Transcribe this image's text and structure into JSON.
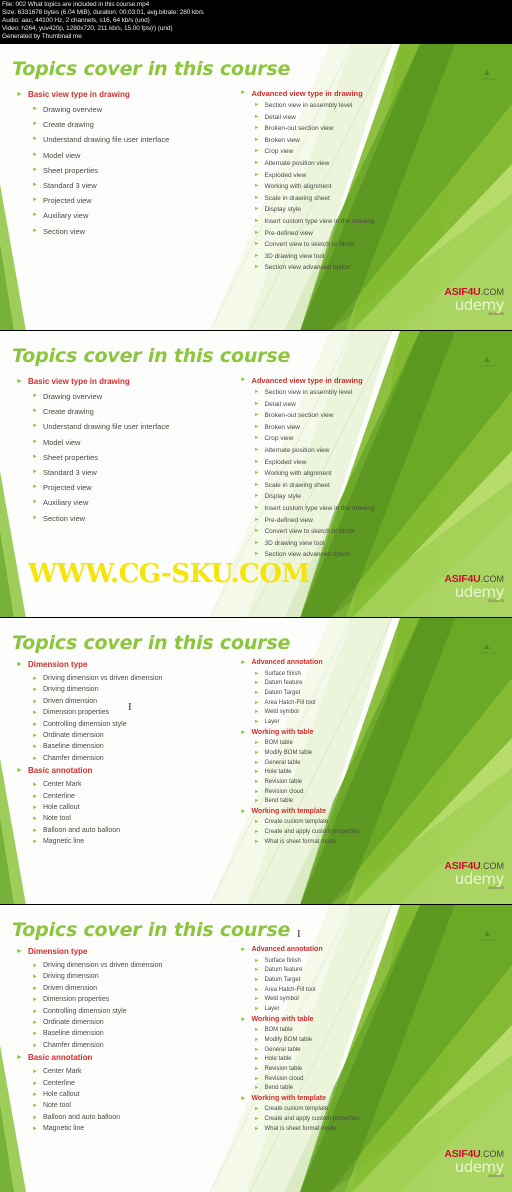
{
  "meta": {
    "lines": [
      "File: 002 What topics are included in this course.mp4",
      "Size: 6331678 bytes (6.04 MiB), duration: 00:03:01, avg.bitrate: 280 kb/s",
      "Audio: aac, 44100 Hz, 2 channels, s16, 64 kb/s (und)",
      "Video: h264, yuv420p, 1280x720, 211 kb/s, 15.00 fps(r) (und)",
      "Generated by Thumbnail me"
    ]
  },
  "branding": {
    "asif": "ASIF4U",
    "com": ".COM",
    "udemy": "udemy",
    "stamp": "00:00:20",
    "corner_mark": "▲",
    "corner_caption": "SolidWorks"
  },
  "watermark": "WWW.CG-SKU.COM",
  "slide_title": "Topics cover in this course",
  "frames": [
    {
      "index": 1,
      "left_column": [
        {
          "type": "heading",
          "label": "Basic view type in drawing"
        },
        {
          "type": "item",
          "label": "Drawing overview"
        },
        {
          "type": "item",
          "label": "Create drawing"
        },
        {
          "type": "item",
          "label": "Understand drawing file user interface"
        },
        {
          "type": "item",
          "label": "Model view"
        },
        {
          "type": "item",
          "label": "Sheet properties"
        },
        {
          "type": "item",
          "label": "Standard 3 view"
        },
        {
          "type": "item",
          "label": "Projected view"
        },
        {
          "type": "item",
          "label": "Auxiliary view"
        },
        {
          "type": "item",
          "label": "Section view"
        }
      ],
      "right_column": [
        {
          "type": "heading",
          "label": "Advanced view type in drawing"
        },
        {
          "type": "item",
          "label": "Section view in assembly level"
        },
        {
          "type": "item",
          "label": "Detail view"
        },
        {
          "type": "item",
          "label": "Broken-out section view"
        },
        {
          "type": "item",
          "label": "Broken view"
        },
        {
          "type": "item",
          "label": "Crop view"
        },
        {
          "type": "item",
          "label": "Alternate position view"
        },
        {
          "type": "item",
          "label": "Exploded view"
        },
        {
          "type": "item",
          "label": "Working with alignment"
        },
        {
          "type": "item",
          "label": "Scale in drawing sheet"
        },
        {
          "type": "item",
          "label": "Display style"
        },
        {
          "type": "item",
          "label": "Insert custom type view in the drawing"
        },
        {
          "type": "item",
          "label": "Pre-defined view"
        },
        {
          "type": "item",
          "label": "Convert view to sketch or block"
        },
        {
          "type": "item",
          "label": "3D drawing view tool"
        },
        {
          "type": "item",
          "label": "Section view advanced option"
        }
      ]
    },
    {
      "index": 2,
      "left_column": [
        {
          "type": "heading",
          "label": "Basic view type in drawing"
        },
        {
          "type": "item",
          "label": "Drawing overview"
        },
        {
          "type": "item",
          "label": "Create drawing"
        },
        {
          "type": "item",
          "label": "Understand drawing file user interface"
        },
        {
          "type": "item",
          "label": "Model view"
        },
        {
          "type": "item",
          "label": "Sheet properties"
        },
        {
          "type": "item",
          "label": "Standard 3 view"
        },
        {
          "type": "item",
          "label": "Projected view"
        },
        {
          "type": "item",
          "label": "Auxiliary view"
        },
        {
          "type": "item",
          "label": "Section view"
        }
      ],
      "right_column": [
        {
          "type": "heading",
          "label": "Advanced view type in drawing"
        },
        {
          "type": "item",
          "label": "Section view in assembly level"
        },
        {
          "type": "item",
          "label": "Detail view"
        },
        {
          "type": "item",
          "label": "Broken-out section view"
        },
        {
          "type": "item",
          "label": "Broken view"
        },
        {
          "type": "item",
          "label": "Crop view"
        },
        {
          "type": "item",
          "label": "Alternate position view"
        },
        {
          "type": "item",
          "label": "Exploded view"
        },
        {
          "type": "item",
          "label": "Working with alignment"
        },
        {
          "type": "item",
          "label": "Scale in drawing sheet"
        },
        {
          "type": "item",
          "label": "Display style"
        },
        {
          "type": "item",
          "label": "Insert custom type view in the drawing"
        },
        {
          "type": "item",
          "label": "Pre-defined view"
        },
        {
          "type": "item",
          "label": "Convert view to sketch or block"
        },
        {
          "type": "item",
          "label": "3D drawing view tool"
        },
        {
          "type": "item",
          "label": "Section view advanced option"
        }
      ]
    },
    {
      "index": 3,
      "left_column": [
        {
          "type": "heading",
          "label": "Dimension type"
        },
        {
          "type": "item",
          "label": "Driving dimension vs driven dimension"
        },
        {
          "type": "item",
          "label": "Driving dimension"
        },
        {
          "type": "item",
          "label": "Driven dimension"
        },
        {
          "type": "item",
          "label": "Dimension properties"
        },
        {
          "type": "item",
          "label": "Controlling dimension style"
        },
        {
          "type": "item",
          "label": "Ordinate dimension"
        },
        {
          "type": "item",
          "label": "Baseline dimension"
        },
        {
          "type": "item",
          "label": "Chamfer dimension"
        },
        {
          "type": "heading",
          "label": "Basic annotation"
        },
        {
          "type": "item",
          "label": "Center Mark"
        },
        {
          "type": "item",
          "label": "Centerline"
        },
        {
          "type": "item",
          "label": "Hole callout"
        },
        {
          "type": "item",
          "label": "Note tool"
        },
        {
          "type": "item",
          "label": "Balloon and auto balloon"
        },
        {
          "type": "item",
          "label": "Magnetic line"
        }
      ],
      "right_column": [
        {
          "type": "heading",
          "label": "Advanced annotation"
        },
        {
          "type": "item",
          "label": "Surface finish"
        },
        {
          "type": "item",
          "label": "Datum feature"
        },
        {
          "type": "item",
          "label": "Datum Target"
        },
        {
          "type": "item",
          "label": "Area Hatch-Fill tool"
        },
        {
          "type": "item",
          "label": "Weld symbol"
        },
        {
          "type": "item",
          "label": "Layer"
        },
        {
          "type": "heading",
          "label": "Working with table"
        },
        {
          "type": "item",
          "label": "BOM table"
        },
        {
          "type": "item",
          "label": "Modify BOM table"
        },
        {
          "type": "item",
          "label": "General table"
        },
        {
          "type": "item",
          "label": "Hole table"
        },
        {
          "type": "item",
          "label": "Revision table"
        },
        {
          "type": "item",
          "label": "Revision cloud"
        },
        {
          "type": "item",
          "label": "Bend table"
        },
        {
          "type": "heading",
          "label": "Working with template"
        },
        {
          "type": "item",
          "label": "Create custom template"
        },
        {
          "type": "item",
          "label": "Create and apply custom properties"
        },
        {
          "type": "item",
          "label": "What is sheet format mode"
        }
      ]
    },
    {
      "index": 4,
      "left_column": [
        {
          "type": "heading",
          "label": "Dimension type"
        },
        {
          "type": "item",
          "label": "Driving dimension vs driven dimension"
        },
        {
          "type": "item",
          "label": "Driving dimension"
        },
        {
          "type": "item",
          "label": "Driven dimension"
        },
        {
          "type": "item",
          "label": "Dimension properties"
        },
        {
          "type": "item",
          "label": "Controlling dimension style"
        },
        {
          "type": "item",
          "label": "Ordinate dimension"
        },
        {
          "type": "item",
          "label": "Baseline dimension"
        },
        {
          "type": "item",
          "label": "Chamfer dimension"
        },
        {
          "type": "heading",
          "label": "Basic annotation"
        },
        {
          "type": "item",
          "label": "Center Mark"
        },
        {
          "type": "item",
          "label": "Centerline"
        },
        {
          "type": "item",
          "label": "Hole callout"
        },
        {
          "type": "item",
          "label": "Note tool"
        },
        {
          "type": "item",
          "label": "Balloon and auto balloon"
        },
        {
          "type": "item",
          "label": "Magnetic line"
        }
      ],
      "right_column": [
        {
          "type": "heading",
          "label": "Advanced annotation"
        },
        {
          "type": "item",
          "label": "Surface finish"
        },
        {
          "type": "item",
          "label": "Datum feature"
        },
        {
          "type": "item",
          "label": "Datum Target"
        },
        {
          "type": "item",
          "label": "Area Hatch-Fill tool"
        },
        {
          "type": "item",
          "label": "Weld symbol"
        },
        {
          "type": "item",
          "label": "Layer"
        },
        {
          "type": "heading",
          "label": "Working with table"
        },
        {
          "type": "item",
          "label": "BOM table"
        },
        {
          "type": "item",
          "label": "Modify BOM table"
        },
        {
          "type": "item",
          "label": "General table"
        },
        {
          "type": "item",
          "label": "Hole table"
        },
        {
          "type": "item",
          "label": "Revision table"
        },
        {
          "type": "item",
          "label": "Revision cloud"
        },
        {
          "type": "item",
          "label": "Bend table"
        },
        {
          "type": "heading",
          "label": "Working with template"
        },
        {
          "type": "item",
          "label": "Create custom template"
        },
        {
          "type": "item",
          "label": "Create and apply custom properties"
        },
        {
          "type": "item",
          "label": "What is sheet format mode"
        }
      ]
    }
  ],
  "colors": {
    "heading": "#cf2e2e",
    "body": "#4a4a44",
    "bullet": "#8cc63e",
    "title": "#8cc63e",
    "watermark": "#f5e400",
    "brand_red": "#c8102e"
  }
}
